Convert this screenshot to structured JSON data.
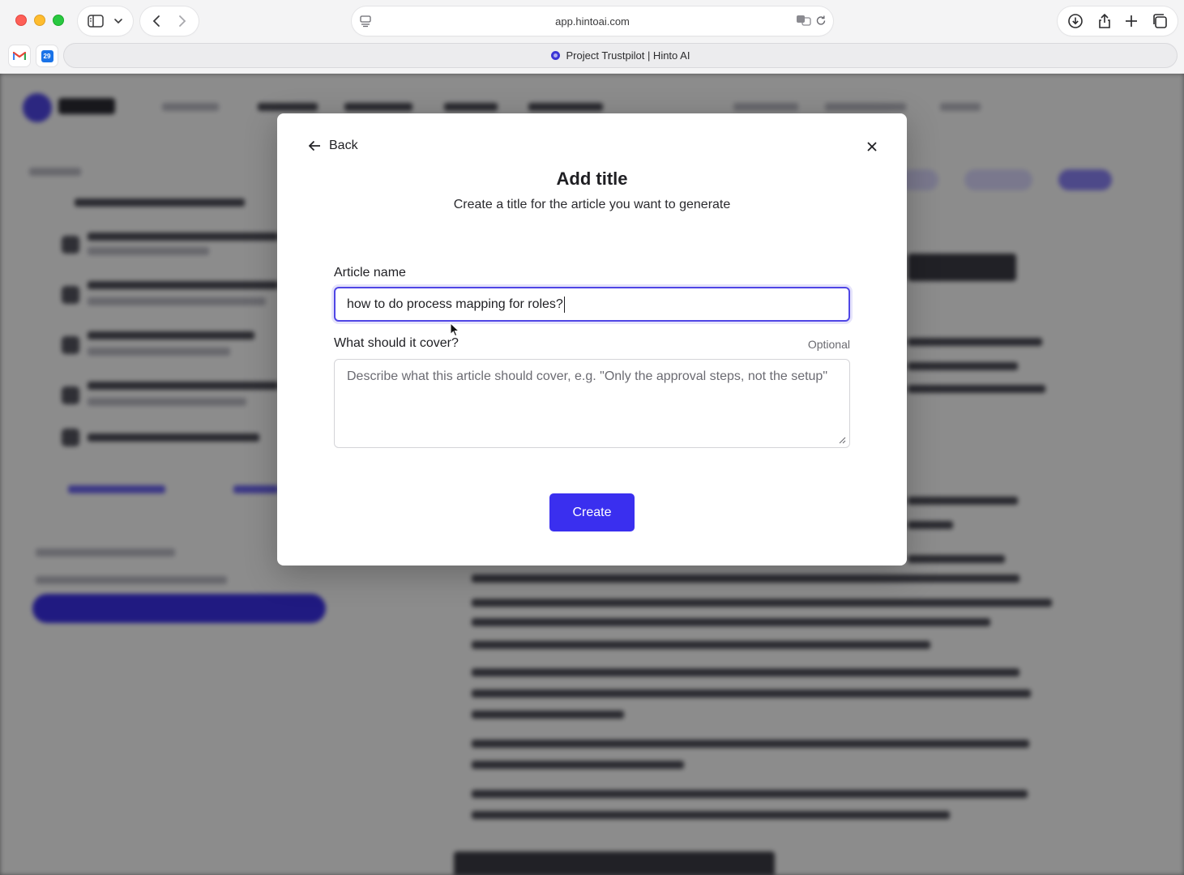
{
  "browser": {
    "url": "app.hintoai.com",
    "tab_title": "Project Trustpilot | Hinto AI",
    "bookmarks": [
      "gmail-icon",
      "calendar-icon"
    ],
    "calendar_day": "29"
  },
  "modal": {
    "back_label": "Back",
    "title": "Add title",
    "subtitle": "Create a title for the article you want to generate",
    "article_name_label": "Article name",
    "article_name_value": "how to do process mapping for roles?",
    "cover_label": "What should it cover?",
    "optional_label": "Optional",
    "cover_placeholder": "Describe what this article should cover, e.g. \"Only the approval steps, not the setup\"",
    "create_label": "Create"
  },
  "colors": {
    "accent": "#3a2fef",
    "focus_border": "#4f46e5"
  }
}
